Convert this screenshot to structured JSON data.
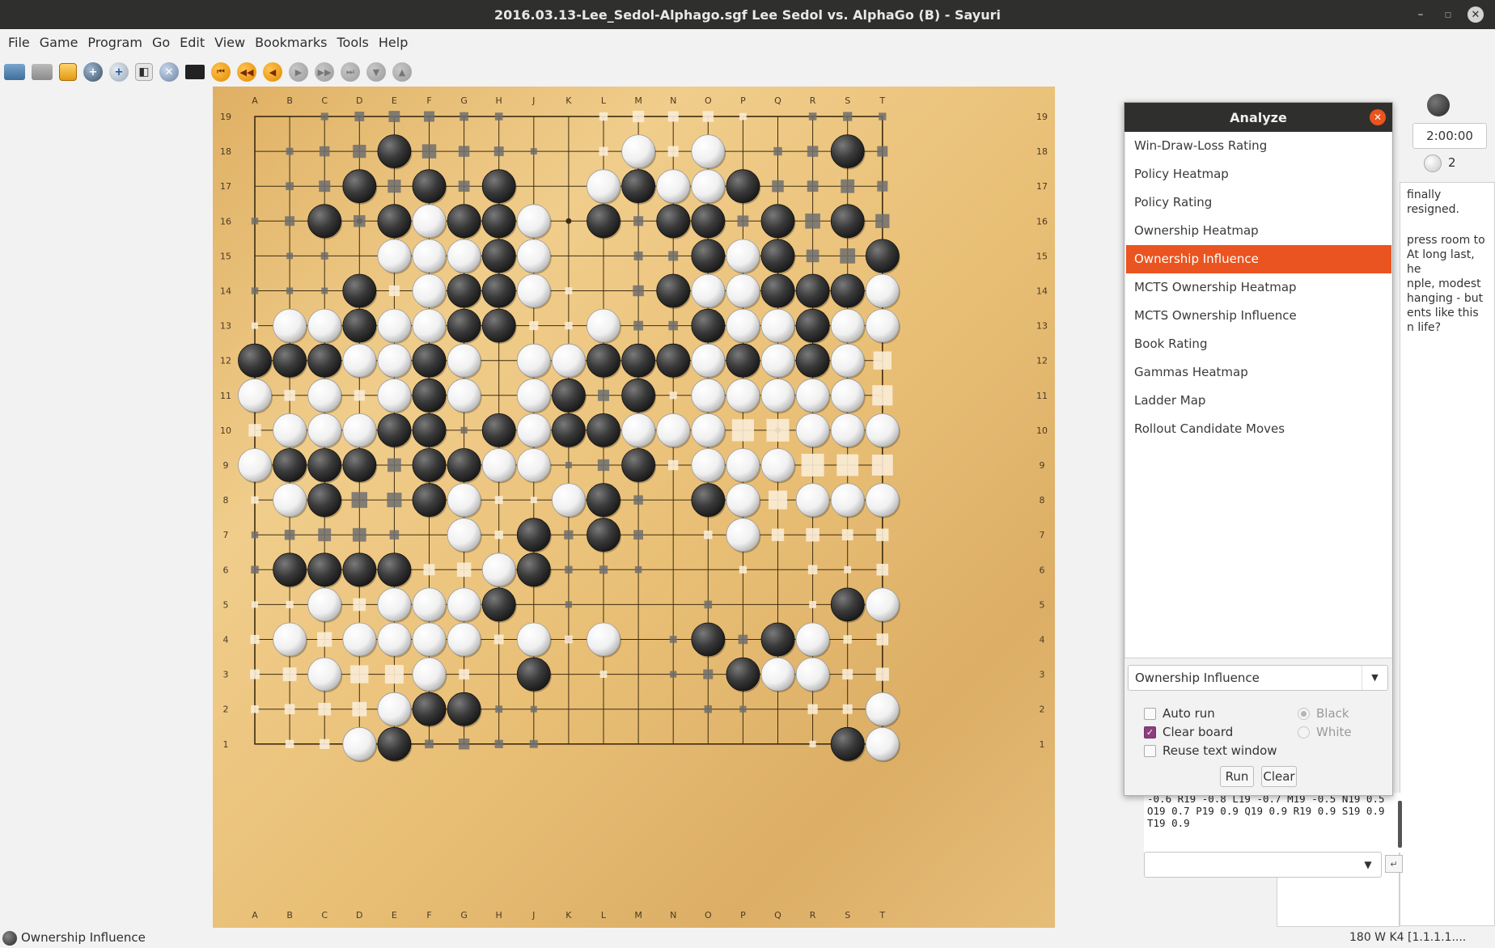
{
  "window": {
    "title": "2016.03.13-Lee_Sedol-Alphago.sgf  Lee Sedol vs. AlphaGo (B) - Sayuri",
    "minimize": "–",
    "maximize": "▫",
    "close": "✕"
  },
  "menubar": {
    "items": [
      "File",
      "Game",
      "Program",
      "Go",
      "Edit",
      "View",
      "Bookmarks",
      "Tools",
      "Help"
    ]
  },
  "toolbar": {
    "icons": [
      "open-folder-icon",
      "closed-folder-icon",
      "save-icon",
      "attach-engine-icon",
      "new-engine-icon",
      "stones-icon",
      "detach-icon",
      "film-icon",
      "first-move-icon",
      "back-ten-icon",
      "back-icon",
      "forward-icon",
      "forward-ten-icon",
      "last-move-icon",
      "next-variation-icon",
      "prev-variation-icon"
    ]
  },
  "board": {
    "columns": [
      "A",
      "B",
      "C",
      "D",
      "E",
      "F",
      "G",
      "H",
      "J",
      "K",
      "L",
      "M",
      "N",
      "O",
      "P",
      "Q",
      "R",
      "S",
      "T"
    ],
    "rows": [
      "19",
      "18",
      "17",
      "16",
      "15",
      "14",
      "13",
      "12",
      "11",
      "10",
      "9",
      "8",
      "7",
      "6",
      "5",
      "4",
      "3",
      "2",
      "1"
    ],
    "stone_rows": [
      "...................",
      "....B......W.W...B.",
      "...B.B.B..WBWWB....",
      "..B.BWBBW.B.BB.B.B.",
      "....WWWBW....BWB..B",
      "...B.WBBW...BWWBBBW",
      ".WWBWWBB..W..BWWBWW",
      "BBBWWBW.WWBBBWBWBW.",
      "W.W.WBW.WB.B.WWWWW.",
      ".WWWBB.BWBBWWW..WWW",
      "WBBB.BBWW..B.WWW...",
      ".WB..BW..WB..BW.WWW",
      "......W.B.B...W....",
      ".BBBB..WB..........",
      "..W.WWWB.........BW",
      ".W.WWWW.W.W..B.BW..",
      "..W..W..B.....BWW..",
      "....WBB...........W",
      "...WB............BW"
    ],
    "influence_note": "Ownership Influence overlay shown as grey (black) and cream (white) squares"
  },
  "side": {
    "clock": "2:00:00",
    "white_captures": "2",
    "comment_lines": [
      "finally resigned.",
      "press room to",
      "At long last, he",
      "nple, modest",
      "hanging - but",
      "ents like this",
      "n life?"
    ]
  },
  "gtp": {
    "output_lines": [
      "-0.6 R19 -0.8 L19 -0.7 M19 -0.5 N19 0.5",
      "O19 0.7 P19 0.9 Q19 0.9 R19 0.9 S19 0.9",
      "T19 0.9"
    ],
    "send_label": "↵"
  },
  "analyze": {
    "title": "Analyze",
    "items": [
      "Win-Draw-Loss Rating",
      "Policy Heatmap",
      "Policy Rating",
      "Ownership Heatmap",
      "Ownership Influence",
      "MCTS Ownership Heatmap",
      "MCTS Ownership Influence",
      "Book Rating",
      "Gammas Heatmap",
      "Ladder Map",
      "Rollout Candidate Moves"
    ],
    "selected_index": 4,
    "combo_value": "Ownership Influence",
    "auto_run_label": "Auto run",
    "clear_board_label": "Clear board",
    "reuse_text_label": "Reuse text window",
    "black_label": "Black",
    "white_label": "White",
    "run_label": "Run",
    "clear_label": "Clear",
    "accent": "#e95420"
  },
  "statusbar": {
    "left": "Ownership Influence",
    "right": "180 W K4 [1.1.1.1...."
  }
}
